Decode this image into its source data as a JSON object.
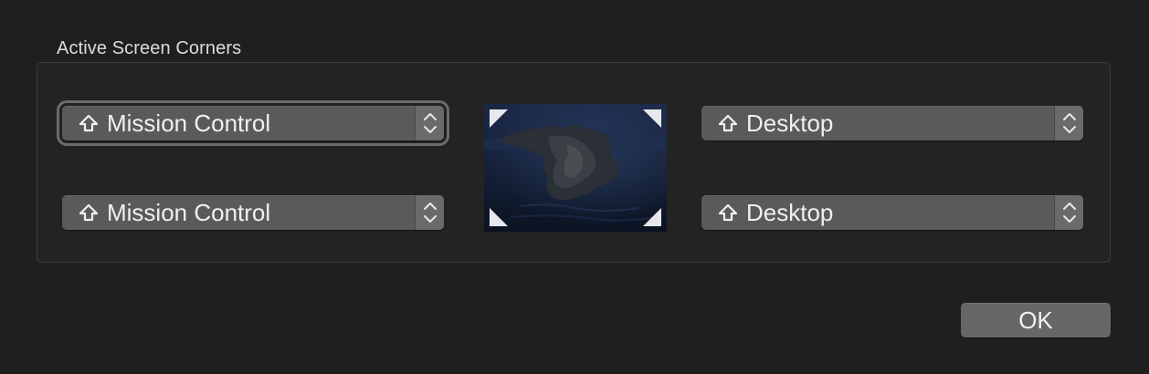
{
  "dialog": {
    "group_title": "Active Screen Corners",
    "ok_label": "OK"
  },
  "corners": {
    "top_left": {
      "label": "Mission Control",
      "modifier_icon": "shift-icon"
    },
    "bottom_left": {
      "label": "Mission Control",
      "modifier_icon": "shift-icon"
    },
    "top_right": {
      "label": "Desktop",
      "modifier_icon": "shift-icon"
    },
    "bottom_right": {
      "label": "Desktop",
      "modifier_icon": "shift-icon"
    }
  },
  "preview": {
    "description_icon": "desktop-wallpaper-preview",
    "corner_markers": [
      "top-left",
      "top-right",
      "bottom-left",
      "bottom-right"
    ]
  },
  "colors": {
    "background": "#1f1f1f",
    "popup": "#5a5a5a",
    "button": "#676767",
    "text": "#f0f0f0"
  }
}
